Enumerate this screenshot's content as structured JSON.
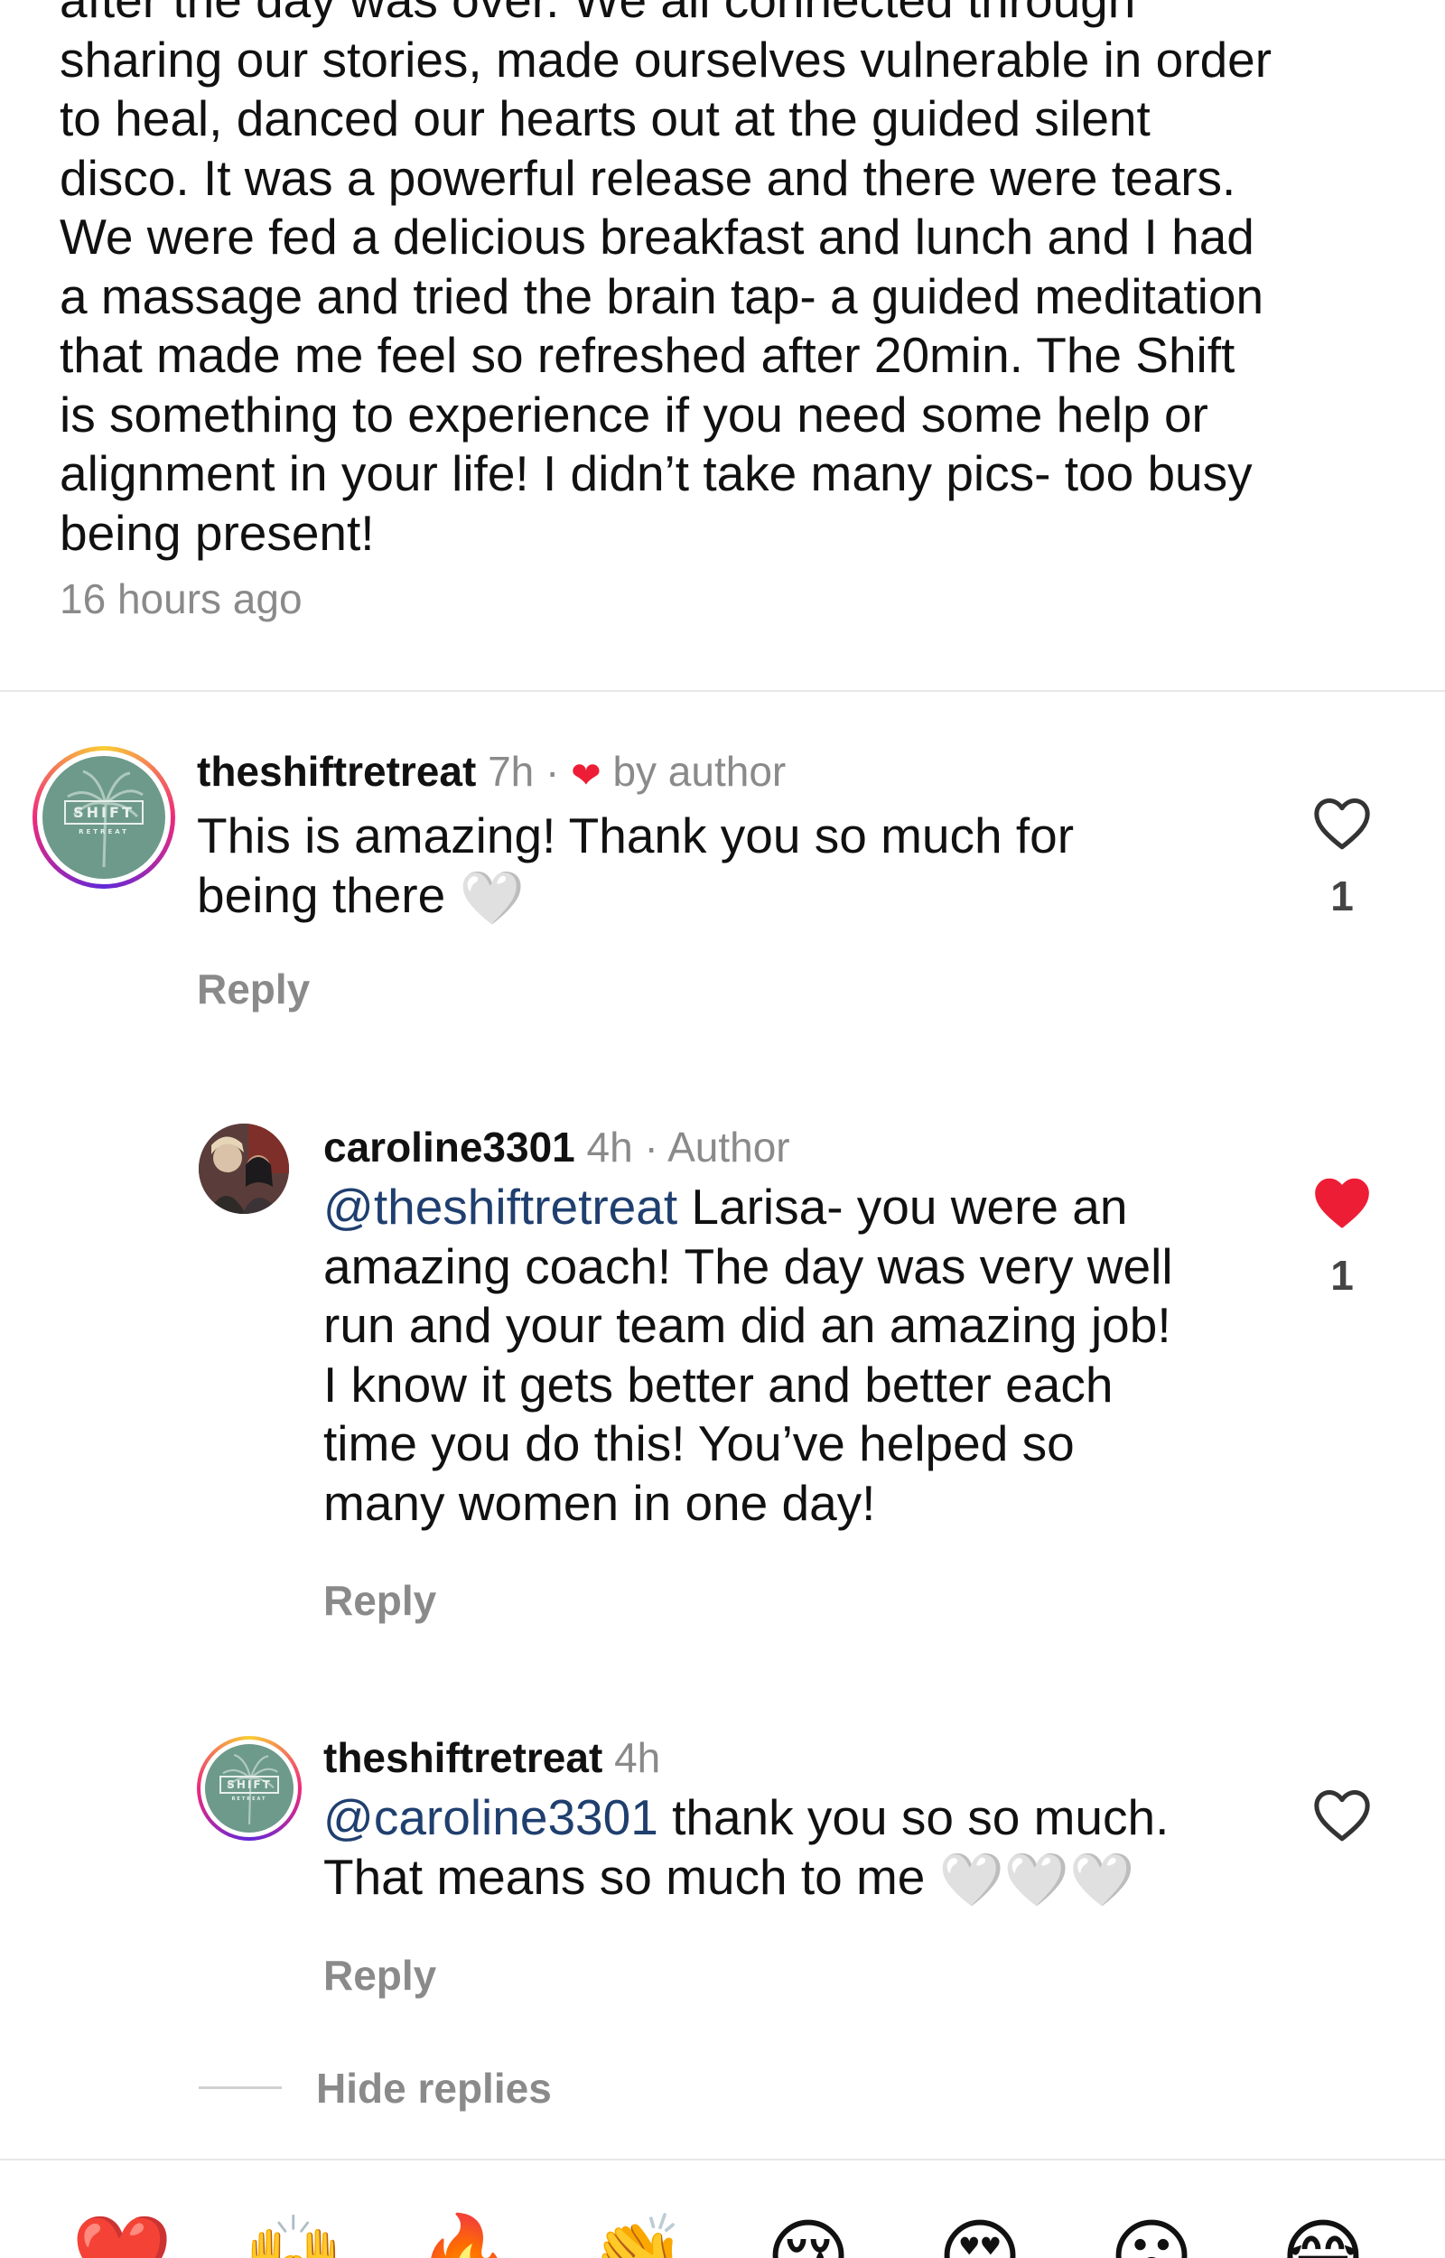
{
  "post": {
    "caption_lines": [
      "after the day was over.  We all connected through",
      "sharing our stories, made ourselves vulnerable in order",
      "to heal, danced our hearts out at the guided silent",
      "disco.  It was a powerful release and there were tears.",
      "We were fed a delicious breakfast and lunch and I had",
      "a massage and tried the brain tap- a guided meditation",
      "that made me feel so refreshed after 20min.  The Shift",
      "is something to experience if you need some help or",
      "alignment in your life! I didn’t take many pics- too busy",
      "being present!"
    ],
    "timestamp": "16 hours ago"
  },
  "comments": [
    {
      "username": "theshiftretreat",
      "time": "7h",
      "separator": "·",
      "badge": "by author",
      "lines": [
        "This is amazing! Thank you so much for",
        "being there"
      ],
      "emoji": "🤍",
      "reply_label": "Reply",
      "like_count": "1",
      "liked": false,
      "avatar_logo_text": "SHIFT",
      "avatar_logo_sub": "RETREAT"
    }
  ],
  "replies": [
    {
      "username": "caroline3301",
      "time": "4h",
      "separator": "·",
      "badge": "Author",
      "mention": "@theshiftretreat",
      "lines": [
        " Larisa- you were an",
        "amazing coach! The day was very well",
        "run and your team did an amazing job!",
        "I know it gets better and better each",
        "time you do this!  You’ve helped so",
        "many women in one day!"
      ],
      "reply_label": "Reply",
      "like_count": "1",
      "liked": true
    },
    {
      "username": "theshiftretreat",
      "time": "4h",
      "mention": "@caroline3301",
      "lines": [
        " thank you so so much.",
        "That means so much to me "
      ],
      "emoji": "🤍🤍🤍",
      "reply_label": "Reply",
      "liked": false,
      "avatar_logo_text": "SHIFT",
      "avatar_logo_sub": "RETREAT"
    }
  ],
  "hide_replies_label": "Hide replies",
  "quick_reactions": [
    "❤️",
    "🙌",
    "🔥",
    "👏",
    "😢",
    "😍",
    "😮",
    "😂"
  ],
  "colors": {
    "like_red": "#ee1d36",
    "mention_blue": "#1f3f6f",
    "muted_gray": "#8a8a8a"
  }
}
